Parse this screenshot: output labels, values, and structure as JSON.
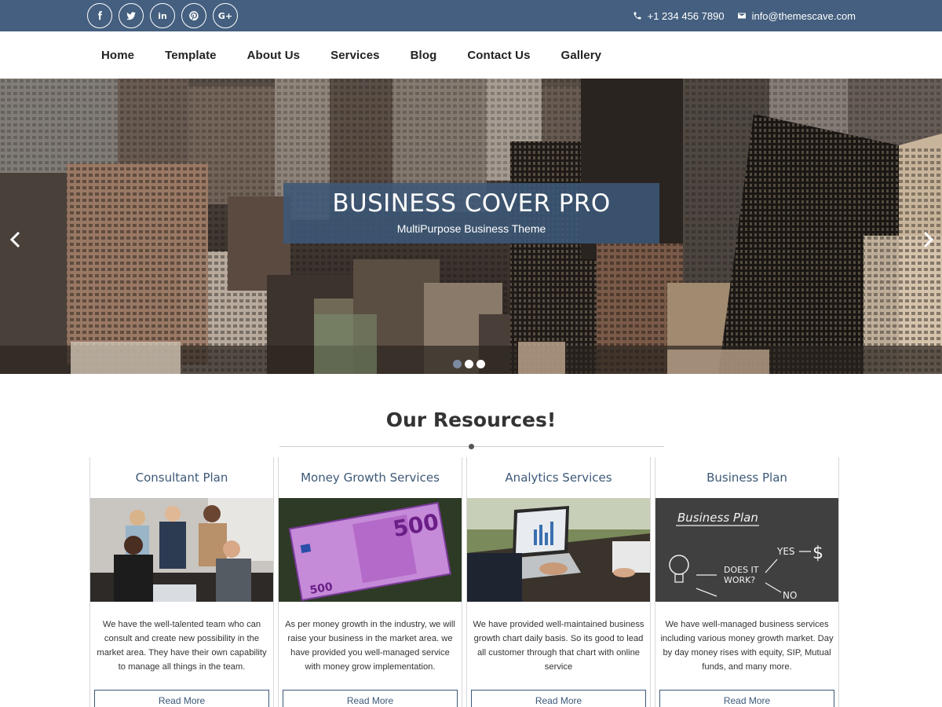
{
  "topbar": {
    "social": [
      {
        "name": "facebook-icon",
        "glyph": "f"
      },
      {
        "name": "twitter-icon",
        "glyph": "t"
      },
      {
        "name": "linkedin-icon",
        "glyph": "in"
      },
      {
        "name": "pinterest-icon",
        "glyph": "p"
      },
      {
        "name": "google-plus-icon",
        "glyph": "G+"
      }
    ],
    "phone_icon": "phone-icon",
    "phone": "+1 234 456 7890",
    "email_icon": "envelope-icon",
    "email": "info@themescave.com"
  },
  "nav": {
    "items": [
      "Home",
      "Template",
      "About Us",
      "Services",
      "Blog",
      "Contact Us",
      "Gallery"
    ]
  },
  "hero": {
    "title": "BUSINESS COVER PRO",
    "subtitle": "MultiPurpose Business Theme",
    "prev_icon": "chevron-left-icon",
    "next_icon": "chevron-right-icon",
    "slides": 3,
    "active_slide": 1
  },
  "resources": {
    "heading": "Our Resources!",
    "cards": [
      {
        "title": "Consultant Plan",
        "image": "team-meeting-photo",
        "text": "We have the well-talented team who can consult and create new possibility in the market area. They have their own capability to manage all things in the team.",
        "button": "Read More"
      },
      {
        "title": "Money Growth Services",
        "image": "euro-banknote-photo",
        "text": "As per money growth in the industry, we will raise your business in the market area. we have provided you well-managed service with money grow implementation.",
        "button": "Read More"
      },
      {
        "title": "Analytics Services",
        "image": "laptop-analytics-photo",
        "text": "We have provided well-maintained business growth chart daily basis. So its good to lead all customer through that chart with online service",
        "button": "Read More"
      },
      {
        "title": "Business Plan",
        "image": "chalkboard-business-plan-photo",
        "text": "We have well-managed business services including various money growth market. Day by day money rises with equity, SIP, Mutual funds, and many more.",
        "button": "Read More",
        "chalk": {
          "heading": "Business Plan",
          "yes": "YES",
          "question": "DOES IT WORK?",
          "no": "NO",
          "dollar": "$"
        }
      }
    ]
  },
  "colors": {
    "brand": "#445f7f",
    "accent_text": "#3c5878"
  }
}
